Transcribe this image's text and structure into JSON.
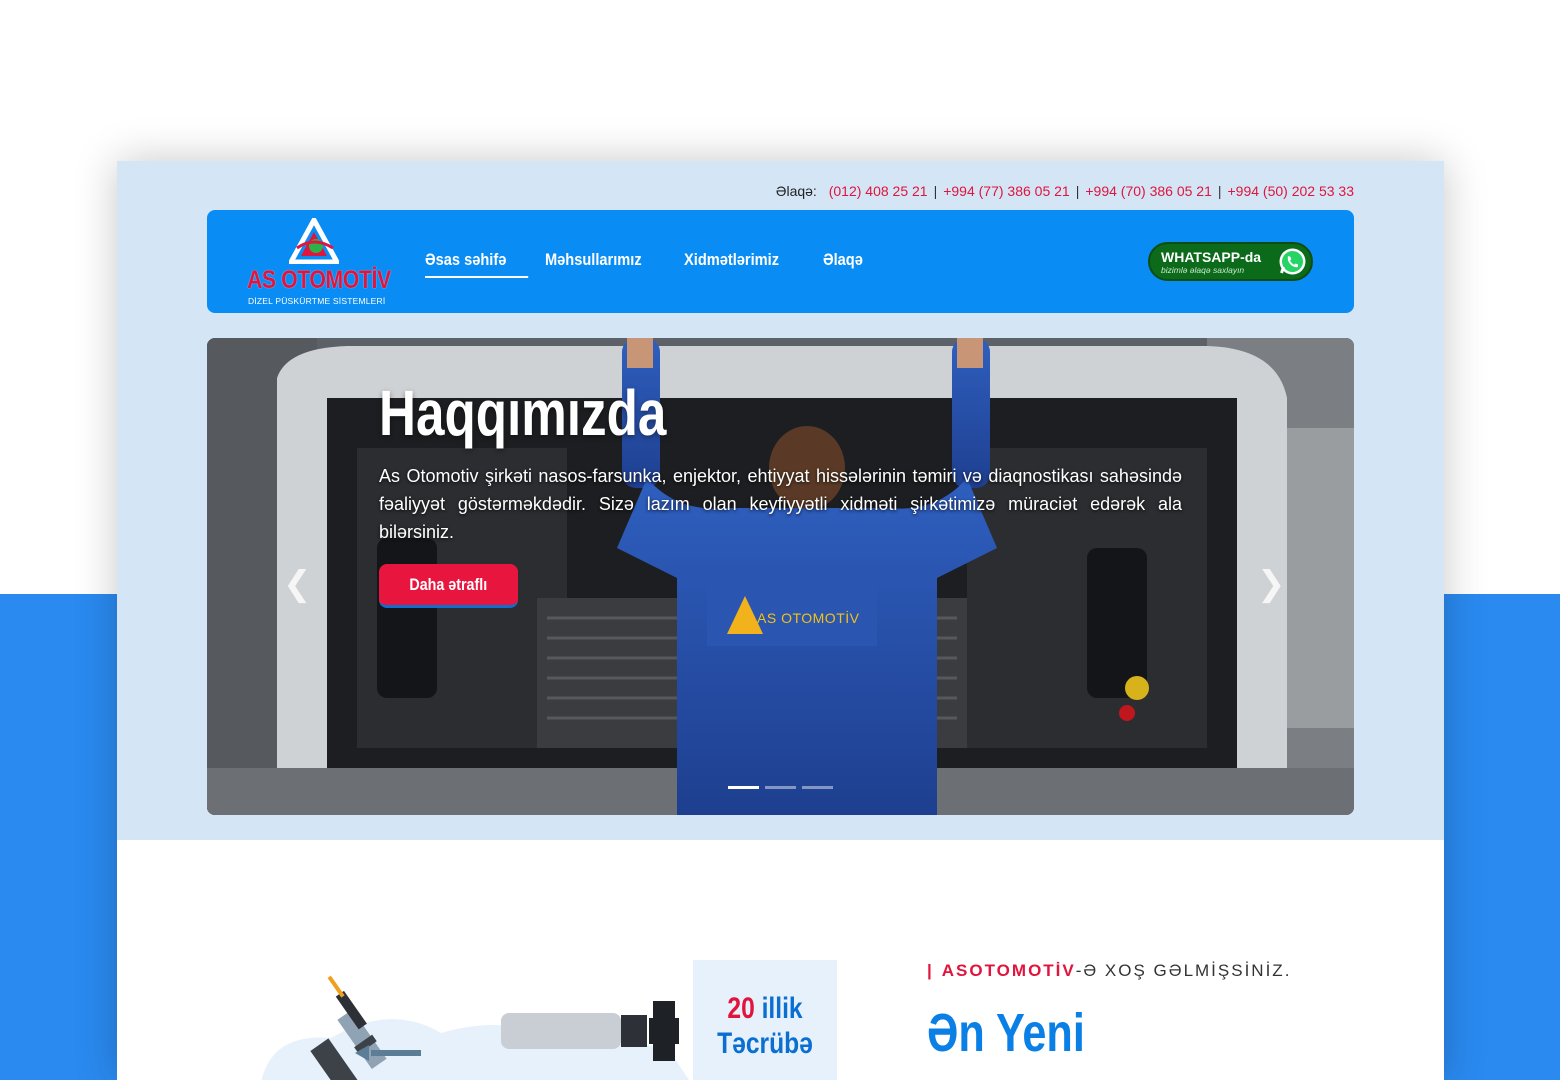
{
  "contact": {
    "label": "Əlaqə:",
    "phones": [
      "(012) 408 25 21",
      "+994 (77) 386 05 21",
      "+994 (70) 386 05 21",
      "+994 (50) 202 53 33"
    ],
    "separator": "|"
  },
  "logo": {
    "title": "AS OTOMOTİV",
    "subtitle": "DİZEL PÜSKÜRTME SİSTEMLERİ"
  },
  "nav": {
    "items": [
      "Əsas səhifə",
      "Məhsullarımız",
      "Xidmətlərimiz",
      "Əlaqə"
    ],
    "active_index": 0
  },
  "whatsapp": {
    "title": "WHATSAPP-da",
    "subtitle": "bizimlə əlaqə saxlayın"
  },
  "hero": {
    "title": "Haqqımızda",
    "text": "As Otomotiv şirkəti nasos-farsunka, enjektor, ehtiyyat hissələrinin təmiri və diaqnostikası sahəsində fəaliyyət göstərməkdədir. Sizə lazım olan keyfiyyətli xidməti şirkətimizə müraciət edərək ala bilərsiniz.",
    "button": "Daha ətraflı",
    "jacket_logo": "AS OTOMOTİV",
    "slide_count": 3,
    "active_slide": 0
  },
  "experience": {
    "number": "20",
    "unit": "illik",
    "label": "Təcrübə"
  },
  "welcome": {
    "bar": "|",
    "brand": "ASOTOMOTİV",
    "rest": "-Ə XOŞ GƏLMİŞSİNİZ."
  },
  "headline": {
    "line1": "Ən Yeni"
  },
  "colors": {
    "accent_red": "#e0143c",
    "nav_blue": "#0a8cf5",
    "page_blue": "#2a8af0",
    "whatsapp_green": "#0b6b1a"
  }
}
